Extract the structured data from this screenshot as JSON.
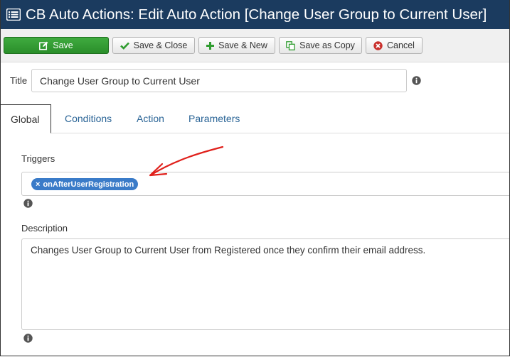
{
  "window": {
    "title": "CB Auto Actions: Edit Auto Action [Change User Group to Current User]",
    "icon": "list-icon"
  },
  "toolbar": {
    "save_label": "Save",
    "save_close_label": "Save & Close",
    "save_new_label": "Save & New",
    "save_copy_label": "Save as Copy",
    "cancel_label": "Cancel"
  },
  "form": {
    "title_label": "Title",
    "title_value": "Change User Group to Current User"
  },
  "tabs": [
    {
      "label": "Global",
      "active": true
    },
    {
      "label": "Conditions",
      "active": false
    },
    {
      "label": "Action",
      "active": false
    },
    {
      "label": "Parameters",
      "active": false
    }
  ],
  "global": {
    "triggers_label": "Triggers",
    "triggers": [
      {
        "remove": "×",
        "label": "onAfterUserRegistration"
      }
    ],
    "description_label": "Description",
    "description_value": "Changes User Group to Current User from Registered once they confirm their email address."
  },
  "colors": {
    "titlebar": "#1b3b5f",
    "save_button": "#2f9c2f",
    "tab_link": "#2a6496",
    "tag": "#3a7bc8",
    "annotation_arrow": "#e0201b"
  }
}
